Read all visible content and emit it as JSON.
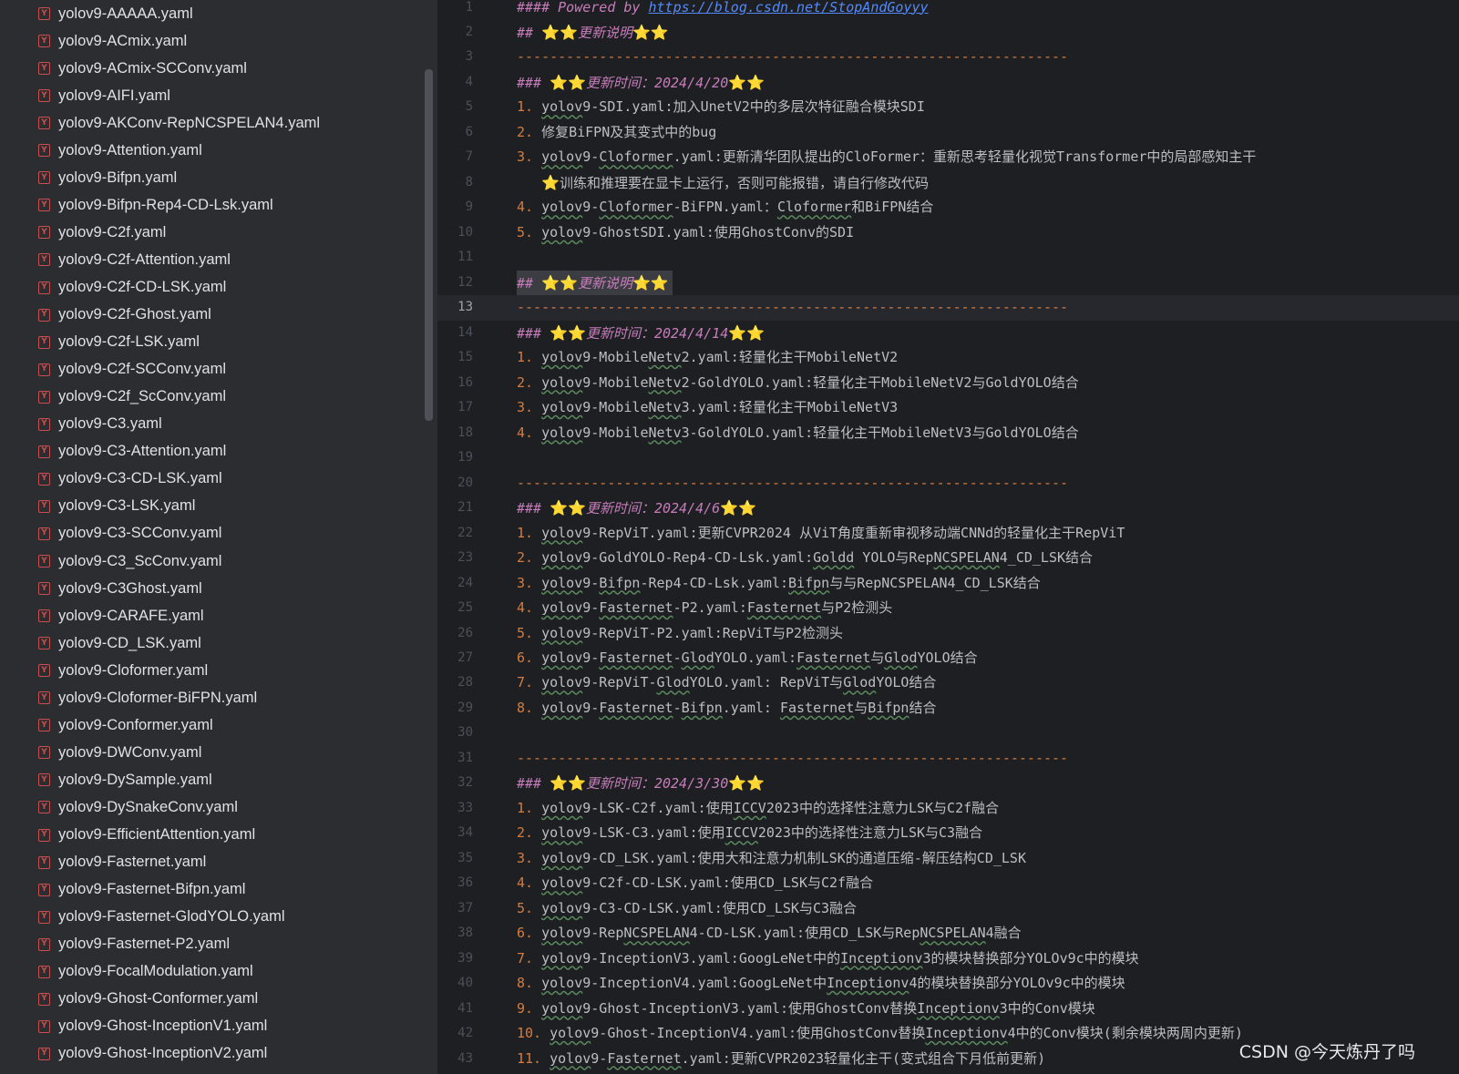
{
  "sidebar": {
    "files": [
      "yolov9-AAAAA.yaml",
      "yolov9-ACmix.yaml",
      "yolov9-ACmix-SCConv.yaml",
      "yolov9-AIFI.yaml",
      "yolov9-AKConv-RepNCSPELAN4.yaml",
      "yolov9-Attention.yaml",
      "yolov9-Bifpn.yaml",
      "yolov9-Bifpn-Rep4-CD-Lsk.yaml",
      "yolov9-C2f.yaml",
      "yolov9-C2f-Attention.yaml",
      "yolov9-C2f-CD-LSK.yaml",
      "yolov9-C2f-Ghost.yaml",
      "yolov9-C2f-LSK.yaml",
      "yolov9-C2f-SCConv.yaml",
      "yolov9-C2f_ScConv.yaml",
      "yolov9-C3.yaml",
      "yolov9-C3-Attention.yaml",
      "yolov9-C3-CD-LSK.yaml",
      "yolov9-C3-LSK.yaml",
      "yolov9-C3-SCConv.yaml",
      "yolov9-C3_ScConv.yaml",
      "yolov9-C3Ghost.yaml",
      "yolov9-CARAFE.yaml",
      "yolov9-CD_LSK.yaml",
      "yolov9-Cloformer.yaml",
      "yolov9-Cloformer-BiFPN.yaml",
      "yolov9-Conformer.yaml",
      "yolov9-DWConv.yaml",
      "yolov9-DySample.yaml",
      "yolov9-DySnakeConv.yaml",
      "yolov9-EfficientAttention.yaml",
      "yolov9-Fasternet.yaml",
      "yolov9-Fasternet-Bifpn.yaml",
      "yolov9-Fasternet-GlodYOLO.yaml",
      "yolov9-Fasternet-P2.yaml",
      "yolov9-FocalModulation.yaml",
      "yolov9-Ghost-Conformer.yaml",
      "yolov9-Ghost-InceptionV1.yaml",
      "yolov9-Ghost-InceptionV2.yaml"
    ],
    "file_icon_letter": "Y",
    "file_icon_color": "#c94f4f"
  },
  "editor": {
    "current_line": 13,
    "lines": [
      [
        {
          "t": "#### Powered by ",
          "c": "h it"
        },
        {
          "t": "https://blog.csdn.net/StopAndGoyyy",
          "c": "lnk"
        }
      ],
      [
        {
          "t": "## ",
          "c": "h it"
        },
        {
          "t": "⭐⭐",
          "c": "star"
        },
        {
          "t": "更新说明",
          "c": "it"
        },
        {
          "t": "⭐⭐",
          "c": "star"
        }
      ],
      [
        {
          "t": "-------------------------------------------------------------------",
          "c": "dash"
        }
      ],
      [
        {
          "t": "### ",
          "c": "h it"
        },
        {
          "t": "⭐⭐",
          "c": "star"
        },
        {
          "t": "更新时间：2024/4/20",
          "c": "it"
        },
        {
          "t": "⭐⭐",
          "c": "star"
        }
      ],
      [
        {
          "t": "1. ",
          "c": "num"
        },
        {
          "t": "yolov",
          "c": "sq"
        },
        {
          "t": "9-SDI.yaml:加入UnetV2中的多层次特征融合模块SDI"
        }
      ],
      [
        {
          "t": "2. ",
          "c": "num"
        },
        {
          "t": "修复BiFPN及其变式中的bug"
        }
      ],
      [
        {
          "t": "3. ",
          "c": "num"
        },
        {
          "t": "yolov",
          "c": "sq"
        },
        {
          "t": "9-"
        },
        {
          "t": "Cloformer",
          "c": "sq"
        },
        {
          "t": ".yaml:更新清华团队提出的CloFormer：重新思考轻量化视觉Transformer中的局部感知主干"
        }
      ],
      [
        {
          "t": "   "
        },
        {
          "t": "⭐",
          "c": "star"
        },
        {
          "t": "训练和推理要在显卡上运行，否则可能报错，请自行修改代码"
        }
      ],
      [
        {
          "t": "4. ",
          "c": "num"
        },
        {
          "t": "yolov",
          "c": "sq"
        },
        {
          "t": "9-"
        },
        {
          "t": "Cloformer",
          "c": "sq"
        },
        {
          "t": "-BiFPN.yaml："
        },
        {
          "t": "Cloformer",
          "c": "sq"
        },
        {
          "t": "和BiFPN结合"
        }
      ],
      [
        {
          "t": "5. ",
          "c": "num"
        },
        {
          "t": "yolov",
          "c": "sq"
        },
        {
          "t": "9-GhostSDI.yaml:使用GhostConv的SDI"
        }
      ],
      [],
      [
        {
          "t": "## ",
          "c": "h it"
        },
        {
          "t": "⭐⭐",
          "c": "star"
        },
        {
          "t": "更新说明",
          "c": "it"
        },
        {
          "t": "⭐⭐",
          "c": "star"
        }
      ],
      [
        {
          "t": "-------------------------------------------------------------------",
          "c": "dash"
        }
      ],
      [
        {
          "t": "### ",
          "c": "h it"
        },
        {
          "t": "⭐⭐",
          "c": "star"
        },
        {
          "t": "更新时间：2024/4/14",
          "c": "it"
        },
        {
          "t": "⭐⭐",
          "c": "star"
        }
      ],
      [
        {
          "t": "1. ",
          "c": "num"
        },
        {
          "t": "yolov",
          "c": "sq"
        },
        {
          "t": "9-Mobile"
        },
        {
          "t": "Netv",
          "c": "sq"
        },
        {
          "t": "2.yaml:轻量化主干MobileNetV2"
        }
      ],
      [
        {
          "t": "2. ",
          "c": "num"
        },
        {
          "t": "yolov",
          "c": "sq"
        },
        {
          "t": "9-Mobile"
        },
        {
          "t": "Netv",
          "c": "sq"
        },
        {
          "t": "2-GoldYOLO.yaml:轻量化主干MobileNetV2与GoldYOLO结合"
        }
      ],
      [
        {
          "t": "3. ",
          "c": "num"
        },
        {
          "t": "yolov",
          "c": "sq"
        },
        {
          "t": "9-Mobile"
        },
        {
          "t": "Netv",
          "c": "sq"
        },
        {
          "t": "3.yaml:轻量化主干MobileNetV3"
        }
      ],
      [
        {
          "t": "4. ",
          "c": "num"
        },
        {
          "t": "yolov",
          "c": "sq"
        },
        {
          "t": "9-Mobile"
        },
        {
          "t": "Netv",
          "c": "sq"
        },
        {
          "t": "3-GoldYOLO.yaml:轻量化主干MobileNetV3与GoldYOLO结合"
        }
      ],
      [],
      [
        {
          "t": "-------------------------------------------------------------------",
          "c": "dash"
        }
      ],
      [
        {
          "t": "### ",
          "c": "h it"
        },
        {
          "t": "⭐⭐",
          "c": "star"
        },
        {
          "t": "更新时间：2024/4/6",
          "c": "it"
        },
        {
          "t": "⭐⭐",
          "c": "star"
        }
      ],
      [
        {
          "t": "1. ",
          "c": "num"
        },
        {
          "t": "yolov",
          "c": "sq"
        },
        {
          "t": "9-RepViT.yaml:更新CVPR2024 从ViT角度重新审视移动端CNNd的轻量化主干RepViT"
        }
      ],
      [
        {
          "t": "2. ",
          "c": "num"
        },
        {
          "t": "yolov",
          "c": "sq"
        },
        {
          "t": "9-GoldYOLO-Rep4-CD-Lsk.yaml:"
        },
        {
          "t": "Goldd",
          "c": "sq"
        },
        {
          "t": " YOLO与Rep"
        },
        {
          "t": "NCSPELAN",
          "c": "sq"
        },
        {
          "t": "4_CD_LSK结合"
        }
      ],
      [
        {
          "t": "3. ",
          "c": "num"
        },
        {
          "t": "yolov",
          "c": "sq"
        },
        {
          "t": "9-"
        },
        {
          "t": "Bifpn",
          "c": "sq"
        },
        {
          "t": "-Rep4-CD-Lsk.yaml:"
        },
        {
          "t": "Bifpn",
          "c": "sq"
        },
        {
          "t": "与与RepNCSPELAN4_CD_LSK结合"
        }
      ],
      [
        {
          "t": "4. ",
          "c": "num"
        },
        {
          "t": "yolov",
          "c": "sq"
        },
        {
          "t": "9-"
        },
        {
          "t": "Fasternet",
          "c": "sq"
        },
        {
          "t": "-P2.yaml:"
        },
        {
          "t": "Fasternet",
          "c": "sq"
        },
        {
          "t": "与P2检测头"
        }
      ],
      [
        {
          "t": "5. ",
          "c": "num"
        },
        {
          "t": "yolov",
          "c": "sq"
        },
        {
          "t": "9-RepViT-P2.yaml:RepViT与P2检测头"
        }
      ],
      [
        {
          "t": "6. ",
          "c": "num"
        },
        {
          "t": "yolov",
          "c": "sq"
        },
        {
          "t": "9-"
        },
        {
          "t": "Fasternet",
          "c": "sq"
        },
        {
          "t": "-"
        },
        {
          "t": "Glod",
          "c": "sq"
        },
        {
          "t": "YOLO.yaml:"
        },
        {
          "t": "Fasternet",
          "c": "sq"
        },
        {
          "t": "与"
        },
        {
          "t": "Glod",
          "c": "sq"
        },
        {
          "t": "YOLO结合"
        }
      ],
      [
        {
          "t": "7. ",
          "c": "num"
        },
        {
          "t": "yolov",
          "c": "sq"
        },
        {
          "t": "9-RepViT-"
        },
        {
          "t": "Glod",
          "c": "sq"
        },
        {
          "t": "YOLO.yaml: RepViT与"
        },
        {
          "t": "Glod",
          "c": "sq"
        },
        {
          "t": "YOLO结合"
        }
      ],
      [
        {
          "t": "8. ",
          "c": "num"
        },
        {
          "t": "yolov",
          "c": "sq"
        },
        {
          "t": "9-"
        },
        {
          "t": "Fasternet",
          "c": "sq"
        },
        {
          "t": "-"
        },
        {
          "t": "Bifpn",
          "c": "sq"
        },
        {
          "t": ".yaml: "
        },
        {
          "t": "Fasternet",
          "c": "sq"
        },
        {
          "t": "与"
        },
        {
          "t": "Bifpn",
          "c": "sq"
        },
        {
          "t": "结合"
        }
      ],
      [],
      [
        {
          "t": "-------------------------------------------------------------------",
          "c": "dash"
        }
      ],
      [
        {
          "t": "### ",
          "c": "h it"
        },
        {
          "t": "⭐⭐",
          "c": "star"
        },
        {
          "t": "更新时间：2024/3/30",
          "c": "it"
        },
        {
          "t": "⭐⭐",
          "c": "star"
        }
      ],
      [
        {
          "t": "1. ",
          "c": "num"
        },
        {
          "t": "yolov",
          "c": "sq"
        },
        {
          "t": "9-LSK-C2f.yaml:使用"
        },
        {
          "t": "ICCV",
          "c": "sq"
        },
        {
          "t": "2023中的选择性注意力LSK与C2f融合"
        }
      ],
      [
        {
          "t": "2. ",
          "c": "num"
        },
        {
          "t": "yolov",
          "c": "sq"
        },
        {
          "t": "9-LSK-C3.yaml:使用"
        },
        {
          "t": "ICCV",
          "c": "sq"
        },
        {
          "t": "2023中的选择性注意力LSK与C3融合"
        }
      ],
      [
        {
          "t": "3. ",
          "c": "num"
        },
        {
          "t": "yolov",
          "c": "sq"
        },
        {
          "t": "9-CD_LSK.yaml:使用大和注意力机制LSK的通道压缩-解压结构CD_LSK"
        }
      ],
      [
        {
          "t": "4. ",
          "c": "num"
        },
        {
          "t": "yolov",
          "c": "sq"
        },
        {
          "t": "9-C2f-CD-LSK.yaml:使用CD_LSK与C2f融合"
        }
      ],
      [
        {
          "t": "5. ",
          "c": "num"
        },
        {
          "t": "yolov",
          "c": "sq"
        },
        {
          "t": "9-C3-CD-LSK.yaml:使用CD_LSK与C3融合"
        }
      ],
      [
        {
          "t": "6. ",
          "c": "num"
        },
        {
          "t": "yolov",
          "c": "sq"
        },
        {
          "t": "9-Rep"
        },
        {
          "t": "NCSPELAN",
          "c": "sq"
        },
        {
          "t": "4-CD-LSK.yaml:使用CD_LSK与Rep"
        },
        {
          "t": "NCSPELAN",
          "c": "sq"
        },
        {
          "t": "4融合"
        }
      ],
      [
        {
          "t": "7. ",
          "c": "num"
        },
        {
          "t": "yolov",
          "c": "sq"
        },
        {
          "t": "9-InceptionV3.yaml:GoogLeNet中的"
        },
        {
          "t": "Inceptionv",
          "c": "sq"
        },
        {
          "t": "3的模块替换部分YOLOv9c中的模块"
        }
      ],
      [
        {
          "t": "8. ",
          "c": "num"
        },
        {
          "t": "yolov",
          "c": "sq"
        },
        {
          "t": "9-InceptionV4.yaml:GoogLeNet中"
        },
        {
          "t": "Inceptionv",
          "c": "sq"
        },
        {
          "t": "4的模块替换部分YOLOv9c中的模块"
        }
      ],
      [
        {
          "t": "9. ",
          "c": "num"
        },
        {
          "t": "yolov",
          "c": "sq"
        },
        {
          "t": "9-Ghost-InceptionV3.yaml:使用GhostConv替换"
        },
        {
          "t": "Inceptionv",
          "c": "sq"
        },
        {
          "t": "3中的Conv模块"
        }
      ],
      [
        {
          "t": "10. ",
          "c": "num"
        },
        {
          "t": "yolov",
          "c": "sq"
        },
        {
          "t": "9-Ghost-InceptionV4.yaml:使用GhostConv替换"
        },
        {
          "t": "Inceptionv",
          "c": "sq"
        },
        {
          "t": "4中的Conv模块(剩余模块两周内更新)"
        }
      ],
      [
        {
          "t": "11. ",
          "c": "num"
        },
        {
          "t": "yolov",
          "c": "sq"
        },
        {
          "t": "9-"
        },
        {
          "t": "Fasternet",
          "c": "sq"
        },
        {
          "t": ".yaml:更新CVPR2023轻量化主干(变式组合下月低前更新)"
        }
      ]
    ]
  },
  "watermark": "CSDN @今天炼丹了吗"
}
